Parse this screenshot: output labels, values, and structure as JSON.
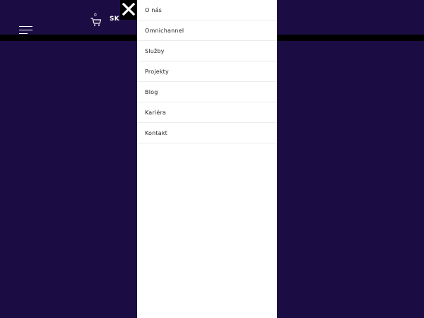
{
  "header": {
    "language": "SK",
    "cart_count": "0",
    "icons": {
      "menu": "hamburger-icon",
      "cart": "cart-icon",
      "close": "close-icon"
    }
  },
  "menu": {
    "items": [
      {
        "label": "O nás"
      },
      {
        "label": "Omnichannel"
      },
      {
        "label": "Služby"
      },
      {
        "label": "Projekty"
      },
      {
        "label": "Blog"
      },
      {
        "label": "Kariéra"
      },
      {
        "label": "Kontakt"
      }
    ]
  },
  "colors": {
    "background": "#1c0c44",
    "header_bar": "#000000",
    "menu_panel": "#ffffff",
    "menu_text": "#222222"
  }
}
